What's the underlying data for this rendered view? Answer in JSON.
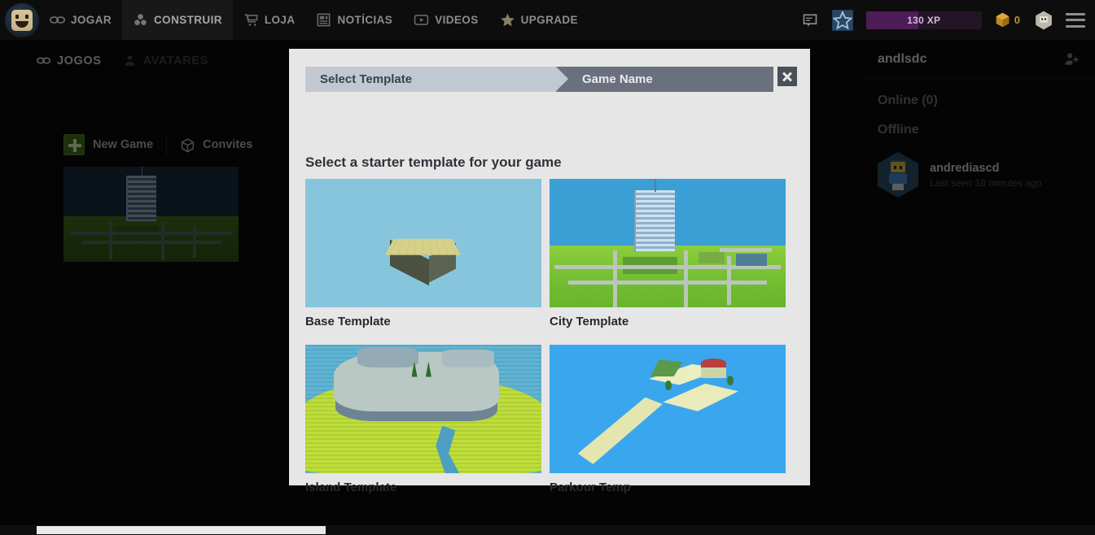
{
  "topnav": {
    "logo_icon": "avatar-face-logo",
    "items": [
      {
        "label": "JOGAR",
        "icon": "gamepad-icon",
        "active": false
      },
      {
        "label": "CONSTRUIR",
        "icon": "blocks-icon",
        "active": true
      },
      {
        "label": "LOJA",
        "icon": "cart-icon",
        "active": false
      },
      {
        "label": "NOTÍCIAS",
        "icon": "news-icon",
        "active": false
      },
      {
        "label": "VIDEOS",
        "icon": "video-icon",
        "active": false
      },
      {
        "label": "UPGRADE",
        "icon": "star-icon",
        "active": false
      }
    ],
    "messages_icon": "message-icon",
    "badge_icon": "star-badge-icon",
    "xp": {
      "text": "130 XP",
      "fill_percent": 45,
      "track_color": "#241428",
      "fill_color": "#4d1d58"
    },
    "currency": {
      "icon": "gold-block-icon",
      "amount": "0",
      "color": "#b99437"
    },
    "profile_icon": "profile-avatar-icon",
    "menu_icon": "hamburger-menu-icon"
  },
  "subtabs": [
    {
      "label": "JOGOS",
      "icon": "gamepad-icon",
      "selected": true
    },
    {
      "label": "AVATARES",
      "icon": "person-icon",
      "selected": false
    }
  ],
  "actions": {
    "new_game_label": "New Game",
    "new_game_icon": "plus-icon",
    "invites_label": "Convites",
    "invites_icon": "box-icon"
  },
  "game_card": {
    "name": "city-game-thumbnail"
  },
  "modal": {
    "steps": [
      {
        "label": "Select Template",
        "state": "current"
      },
      {
        "label": "Game Name",
        "state": "upcoming"
      }
    ],
    "close_icon": "close-icon",
    "title": "Select a starter template for your game",
    "templates": [
      {
        "label": "Base Template",
        "art": "base-baseplate"
      },
      {
        "label": "City Template",
        "art": "city-scene"
      },
      {
        "label": "Island Template",
        "art": "island-scene"
      },
      {
        "label": "Parkour Temp",
        "art": "parkour-scene"
      }
    ]
  },
  "friends": {
    "username": "andlsdc",
    "add_friend_icon": "add-friend-icon",
    "online_label": "Online (0)",
    "offline_label": "Offline",
    "offline_list": [
      {
        "name": "andrediascd",
        "status": "Last seen 18 minutes ago",
        "avatar": "minifigure-avatar"
      }
    ]
  },
  "scrollbar": {
    "name": "horizontal-scrollbar"
  },
  "colors": {
    "page_bg": "#0b0b0b",
    "nav_bg": "#0d0d0d",
    "modal_bg": "#e6e6e6",
    "step_current": "#c2c8d2",
    "step_upcoming": "#6a707c",
    "accent_green": "#3f6a1d"
  }
}
